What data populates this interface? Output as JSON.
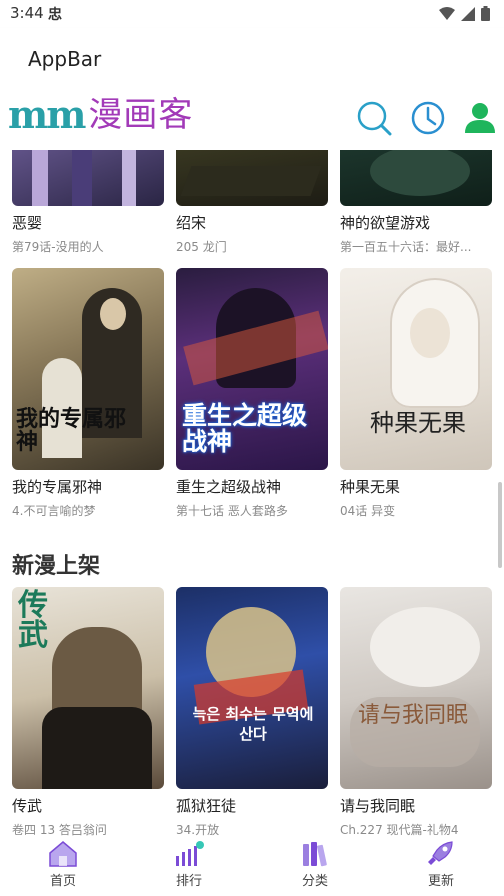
{
  "status": {
    "time": "3:44",
    "carrier": "忠"
  },
  "appbar": {
    "title": "AppBar"
  },
  "header": {
    "logo_mm": "mm",
    "logo_text": "漫画客"
  },
  "row1": [
    {
      "title": "恶婴",
      "sub": "第79话-没用的人"
    },
    {
      "title": "绍宋",
      "sub": "205 龙门"
    },
    {
      "title": "神的欲望游戏",
      "sub": "第一百五十六话：最好..."
    }
  ],
  "row2": [
    {
      "title": "我的专属邪神",
      "sub": "4.不可言喻的梦",
      "cover_text": "我的专属邪神"
    },
    {
      "title": "重生之超级战神",
      "sub": "第十七话 恶人套路多",
      "cover_text": "重生之超级战神"
    },
    {
      "title": "种果无果",
      "sub": "04话 异变",
      "cover_text": "种果无果"
    }
  ],
  "section_new": "新漫上架",
  "row3": [
    {
      "title": "传武",
      "sub": "卷四 13 答吕翁问",
      "cover_text": "传武"
    },
    {
      "title": "孤狱狂徒",
      "sub": "34.开放",
      "cover_text": "늑은 최수는 무역에 산다"
    },
    {
      "title": "请与我同眠",
      "sub": "Ch.227 现代篇-礼物4",
      "cover_text": "请与我同眠"
    }
  ],
  "nav": [
    {
      "label": "首页",
      "icon": "home-icon"
    },
    {
      "label": "排行",
      "icon": "ranking-icon"
    },
    {
      "label": "分类",
      "icon": "category-icon"
    },
    {
      "label": "更新",
      "icon": "rocket-icon"
    }
  ],
  "colors": {
    "accent": "#2aa0a8",
    "purple": "#7b4bd6",
    "green": "#1fb55c"
  }
}
